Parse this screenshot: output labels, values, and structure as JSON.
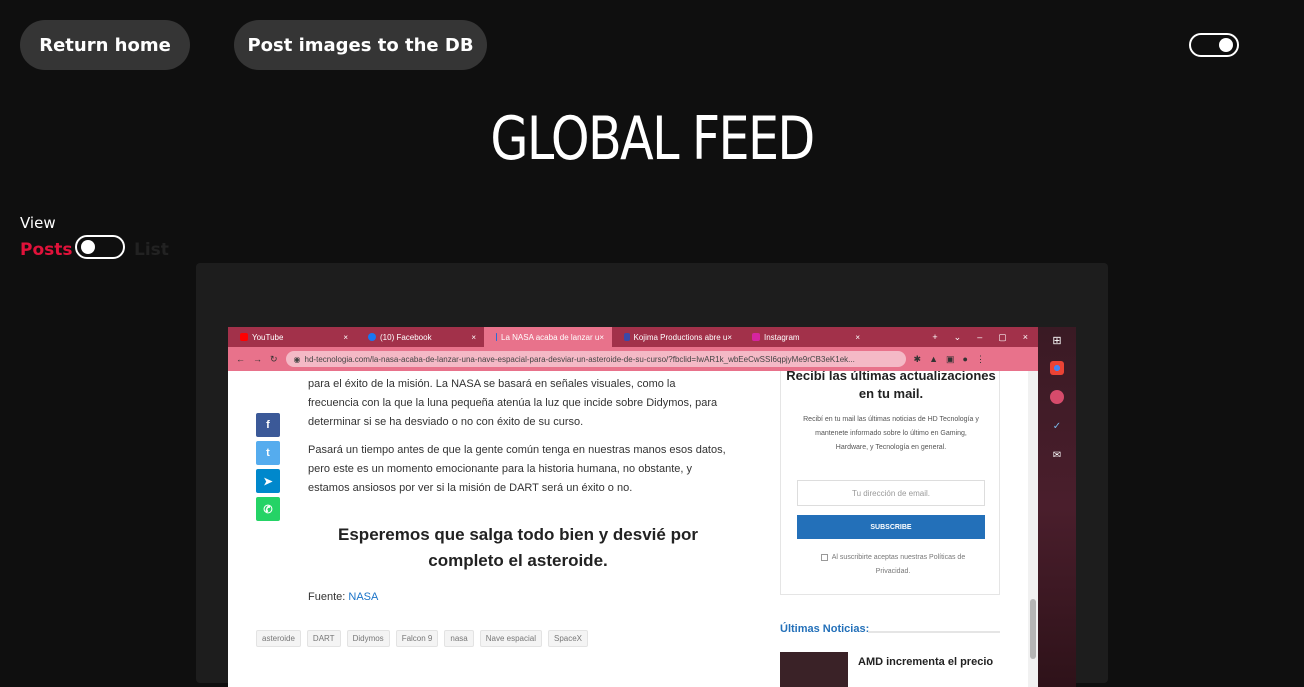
{
  "header": {
    "return_home_label": "Return home",
    "post_images_label": "Post images to the DB",
    "title": "GLOBAL FEED"
  },
  "view_switch": {
    "label": "View",
    "option_posts": "Posts",
    "option_list": "List",
    "selected": "Posts"
  },
  "colors": {
    "background": "#0f0f0f",
    "button_bg": "#353535",
    "accent": "#e0123a",
    "card_bg": "#1d1d1d"
  },
  "post_image": {
    "tabs": [
      {
        "label": "YouTube",
        "icon": "youtube-icon",
        "color": "#ff0000"
      },
      {
        "label": "(10) Facebook",
        "icon": "facebook-icon",
        "color": "#1877f2"
      },
      {
        "label": "La NASA acaba de lanzar u",
        "icon": "site-icon",
        "color": "#2a6ad6"
      },
      {
        "label": "Kojima Productions abre u",
        "icon": "site-icon",
        "color": "#3b49a8"
      },
      {
        "label": "Instagram",
        "icon": "instagram-icon",
        "color": "#d6249f"
      }
    ],
    "url": "hd-tecnologia.com/la-nasa-acaba-de-lanzar-una-nave-espacial-para-desviar-un-asteroide-de-su-curso/?fbclid=IwAR1k_wbEeCwSSI6qpjyMe9rCB3eK1ek...",
    "article_paragraphs": [
      "para el éxito de la misión. La NASA se basará en señales visuales, como la frecuencia con la que la luna pequeña atenúa la luz que incide sobre Didymos, para determinar si se ha desviado o no con éxito de su curso.",
      "Pasará un tiempo antes de que la gente común tenga en nuestras manos esos datos, pero este es un momento emocionante para la historia humana, no obstante, y estamos ansiosos por ver si la misión de DART será un éxito o no."
    ],
    "pullquote": "Esperemos que salga todo bien y desvié por completo el asteroide.",
    "source_prefix": "Fuente:",
    "source_link": "NASA",
    "tags": [
      "asteroide",
      "DART",
      "Didymos",
      "Falcon 9",
      "nasa",
      "Nave espacial",
      "SpaceX"
    ],
    "newsletter": {
      "title": "Recibí las últimas actualizaciones en tu mail.",
      "text": "Recibí en tu mail las últimas noticias de HD Tecnología y mantenete informado sobre lo último en Gaming, Hardware, y Tecnología en general.",
      "email_placeholder": "Tu dirección de email.",
      "subscribe_label": "SUBSCRIBE",
      "terms": "Al suscribirte aceptas nuestras Políticas de Privacidad."
    },
    "news_heading": "Últimas Noticias:",
    "news_first_title": "AMD incrementa el precio"
  }
}
